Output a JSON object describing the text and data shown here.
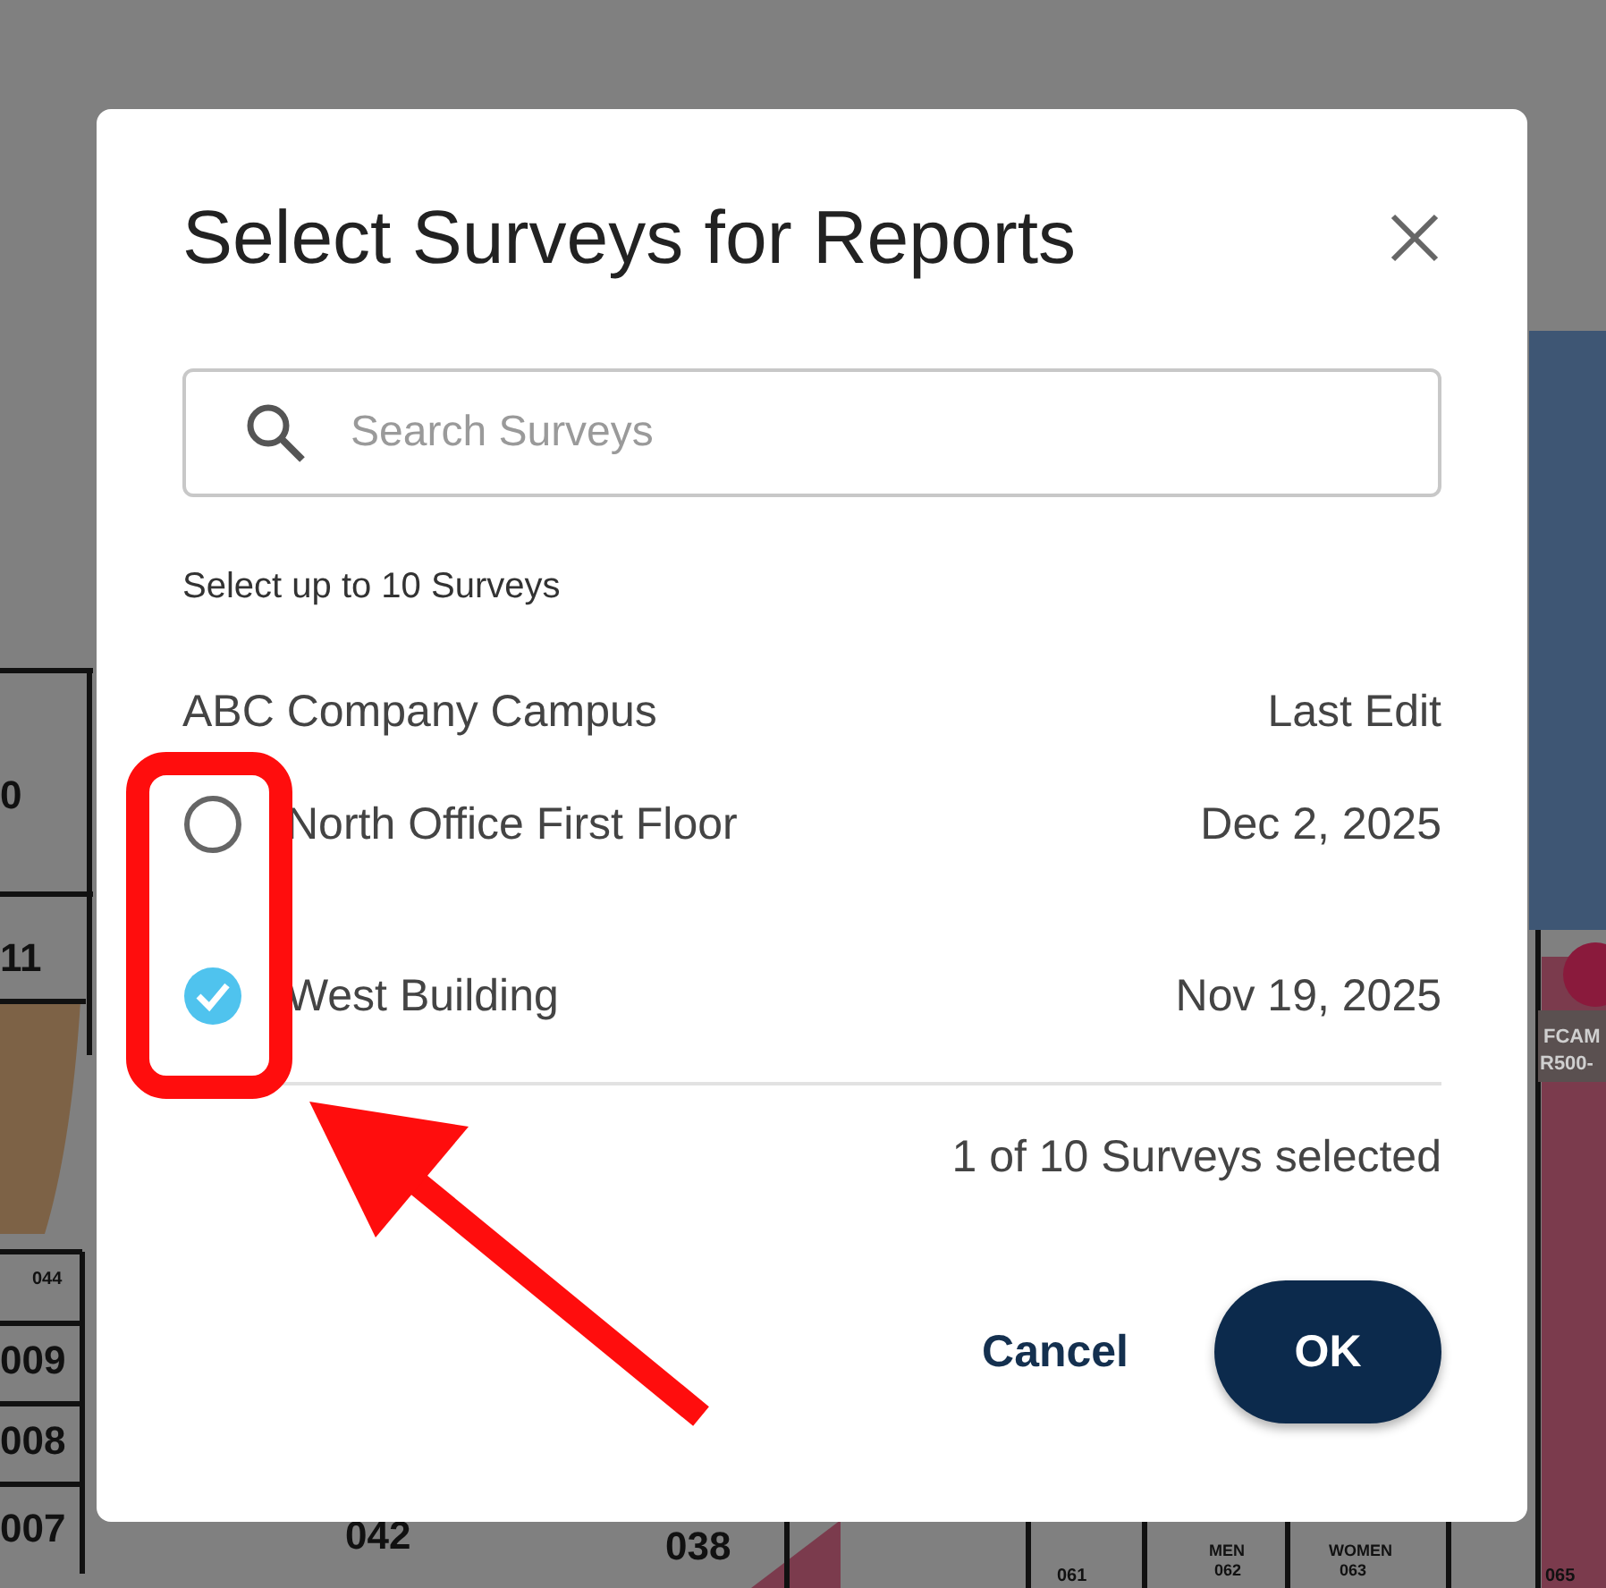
{
  "floor_plan": {
    "labels": [
      {
        "text": "0",
        "kind": "room"
      },
      {
        "text": "11",
        "kind": "room"
      },
      {
        "text": "FCAM",
        "kind": "tag"
      },
      {
        "text": "R500-",
        "kind": "tag"
      },
      {
        "text": "044",
        "kind": "small"
      },
      {
        "text": "009",
        "kind": "room"
      },
      {
        "text": "008",
        "kind": "room"
      },
      {
        "text": "007",
        "kind": "room"
      },
      {
        "text": "042",
        "kind": "room"
      },
      {
        "text": "038",
        "kind": "room"
      },
      {
        "text": "061",
        "kind": "small"
      },
      {
        "text": "MEN",
        "kind": "tiny"
      },
      {
        "text": "062",
        "kind": "tiny"
      },
      {
        "text": "WOMEN",
        "kind": "tiny"
      },
      {
        "text": "063",
        "kind": "tiny"
      },
      {
        "text": "065",
        "kind": "small"
      }
    ]
  },
  "dialog": {
    "title": "Select Surveys for Reports",
    "search": {
      "placeholder": "Search Surveys"
    },
    "hint": "Select up to 10 Surveys",
    "group": "ABC Company Campus",
    "column": "Last Edit",
    "rows": [
      {
        "name": "North Office First Floor",
        "date": "Dec 2, 2025",
        "selected": false
      },
      {
        "name": "West Building",
        "date": "Nov 19, 2025",
        "selected": true
      }
    ],
    "summary": "1 of 10 Surveys selected",
    "buttons": [
      {
        "label": "Cancel",
        "kind": "text"
      },
      {
        "label": "OK",
        "kind": "primary"
      }
    ]
  }
}
